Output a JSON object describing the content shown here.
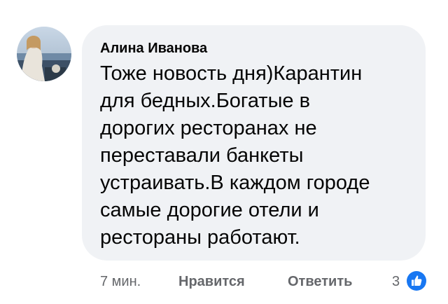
{
  "comment": {
    "author": "Алина Иванова",
    "text_lines": [
      "Тоже новость дня)Карантин",
      "для бедных.Богатые в",
      "дорогих ресторанах не",
      "переставали банкеты",
      "устраивать.В каждом городе",
      "самые дорогие отели и",
      "рестораны работают."
    ],
    "time": "7 мин.",
    "like_label": "Нравится",
    "reply_label": "Ответить",
    "reaction_count": "3",
    "reaction_icon": "thumbs-up-icon"
  },
  "colors": {
    "bubble_bg": "#f0f2f5",
    "author_text": "#050505",
    "meta_text": "#65676b",
    "like_blue": "#1877f2"
  }
}
